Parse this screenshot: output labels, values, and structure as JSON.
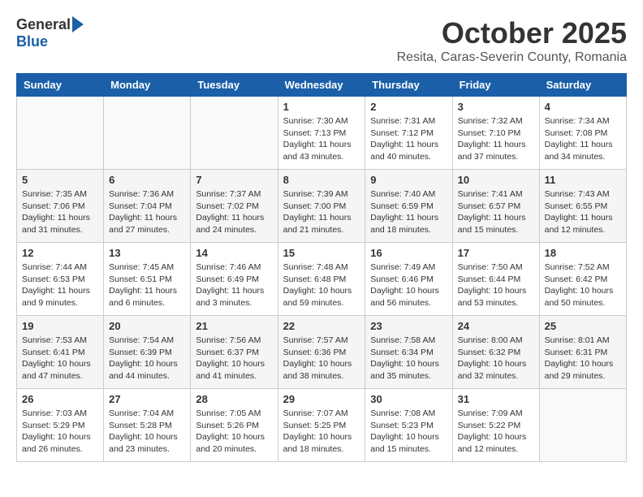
{
  "header": {
    "logo_general": "General",
    "logo_blue": "Blue",
    "month_title": "October 2025",
    "subtitle": "Resita, Caras-Severin County, Romania"
  },
  "weekdays": [
    "Sunday",
    "Monday",
    "Tuesday",
    "Wednesday",
    "Thursday",
    "Friday",
    "Saturday"
  ],
  "weeks": [
    [
      {
        "day": "",
        "info": ""
      },
      {
        "day": "",
        "info": ""
      },
      {
        "day": "",
        "info": ""
      },
      {
        "day": "1",
        "info": "Sunrise: 7:30 AM\nSunset: 7:13 PM\nDaylight: 11 hours\nand 43 minutes."
      },
      {
        "day": "2",
        "info": "Sunrise: 7:31 AM\nSunset: 7:12 PM\nDaylight: 11 hours\nand 40 minutes."
      },
      {
        "day": "3",
        "info": "Sunrise: 7:32 AM\nSunset: 7:10 PM\nDaylight: 11 hours\nand 37 minutes."
      },
      {
        "day": "4",
        "info": "Sunrise: 7:34 AM\nSunset: 7:08 PM\nDaylight: 11 hours\nand 34 minutes."
      }
    ],
    [
      {
        "day": "5",
        "info": "Sunrise: 7:35 AM\nSunset: 7:06 PM\nDaylight: 11 hours\nand 31 minutes."
      },
      {
        "day": "6",
        "info": "Sunrise: 7:36 AM\nSunset: 7:04 PM\nDaylight: 11 hours\nand 27 minutes."
      },
      {
        "day": "7",
        "info": "Sunrise: 7:37 AM\nSunset: 7:02 PM\nDaylight: 11 hours\nand 24 minutes."
      },
      {
        "day": "8",
        "info": "Sunrise: 7:39 AM\nSunset: 7:00 PM\nDaylight: 11 hours\nand 21 minutes."
      },
      {
        "day": "9",
        "info": "Sunrise: 7:40 AM\nSunset: 6:59 PM\nDaylight: 11 hours\nand 18 minutes."
      },
      {
        "day": "10",
        "info": "Sunrise: 7:41 AM\nSunset: 6:57 PM\nDaylight: 11 hours\nand 15 minutes."
      },
      {
        "day": "11",
        "info": "Sunrise: 7:43 AM\nSunset: 6:55 PM\nDaylight: 11 hours\nand 12 minutes."
      }
    ],
    [
      {
        "day": "12",
        "info": "Sunrise: 7:44 AM\nSunset: 6:53 PM\nDaylight: 11 hours\nand 9 minutes."
      },
      {
        "day": "13",
        "info": "Sunrise: 7:45 AM\nSunset: 6:51 PM\nDaylight: 11 hours\nand 6 minutes."
      },
      {
        "day": "14",
        "info": "Sunrise: 7:46 AM\nSunset: 6:49 PM\nDaylight: 11 hours\nand 3 minutes."
      },
      {
        "day": "15",
        "info": "Sunrise: 7:48 AM\nSunset: 6:48 PM\nDaylight: 10 hours\nand 59 minutes."
      },
      {
        "day": "16",
        "info": "Sunrise: 7:49 AM\nSunset: 6:46 PM\nDaylight: 10 hours\nand 56 minutes."
      },
      {
        "day": "17",
        "info": "Sunrise: 7:50 AM\nSunset: 6:44 PM\nDaylight: 10 hours\nand 53 minutes."
      },
      {
        "day": "18",
        "info": "Sunrise: 7:52 AM\nSunset: 6:42 PM\nDaylight: 10 hours\nand 50 minutes."
      }
    ],
    [
      {
        "day": "19",
        "info": "Sunrise: 7:53 AM\nSunset: 6:41 PM\nDaylight: 10 hours\nand 47 minutes."
      },
      {
        "day": "20",
        "info": "Sunrise: 7:54 AM\nSunset: 6:39 PM\nDaylight: 10 hours\nand 44 minutes."
      },
      {
        "day": "21",
        "info": "Sunrise: 7:56 AM\nSunset: 6:37 PM\nDaylight: 10 hours\nand 41 minutes."
      },
      {
        "day": "22",
        "info": "Sunrise: 7:57 AM\nSunset: 6:36 PM\nDaylight: 10 hours\nand 38 minutes."
      },
      {
        "day": "23",
        "info": "Sunrise: 7:58 AM\nSunset: 6:34 PM\nDaylight: 10 hours\nand 35 minutes."
      },
      {
        "day": "24",
        "info": "Sunrise: 8:00 AM\nSunset: 6:32 PM\nDaylight: 10 hours\nand 32 minutes."
      },
      {
        "day": "25",
        "info": "Sunrise: 8:01 AM\nSunset: 6:31 PM\nDaylight: 10 hours\nand 29 minutes."
      }
    ],
    [
      {
        "day": "26",
        "info": "Sunrise: 7:03 AM\nSunset: 5:29 PM\nDaylight: 10 hours\nand 26 minutes."
      },
      {
        "day": "27",
        "info": "Sunrise: 7:04 AM\nSunset: 5:28 PM\nDaylight: 10 hours\nand 23 minutes."
      },
      {
        "day": "28",
        "info": "Sunrise: 7:05 AM\nSunset: 5:26 PM\nDaylight: 10 hours\nand 20 minutes."
      },
      {
        "day": "29",
        "info": "Sunrise: 7:07 AM\nSunset: 5:25 PM\nDaylight: 10 hours\nand 18 minutes."
      },
      {
        "day": "30",
        "info": "Sunrise: 7:08 AM\nSunset: 5:23 PM\nDaylight: 10 hours\nand 15 minutes."
      },
      {
        "day": "31",
        "info": "Sunrise: 7:09 AM\nSunset: 5:22 PM\nDaylight: 10 hours\nand 12 minutes."
      },
      {
        "day": "",
        "info": ""
      }
    ]
  ]
}
